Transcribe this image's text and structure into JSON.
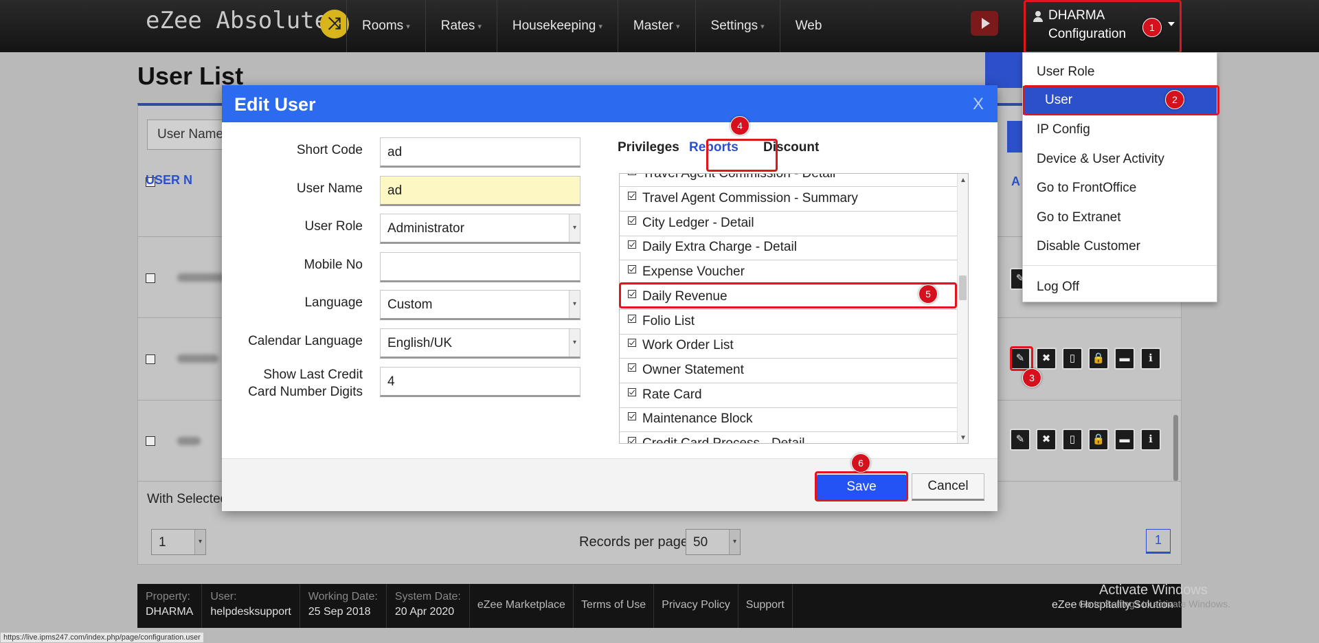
{
  "app": {
    "brand": "eZee Absolute",
    "nav": [
      "Rooms",
      "Rates",
      "Housekeeping",
      "Master",
      "Settings",
      "Web"
    ],
    "user_name": "DHARMA",
    "user_role": "Configuration"
  },
  "user_menu": {
    "items": [
      "User Role",
      "User",
      "IP Config",
      "Device & User Activity",
      "Go to FrontOffice",
      "Go to Extranet",
      "Disable Customer",
      "Log Off"
    ],
    "active": "User"
  },
  "page": {
    "title": "User List",
    "filter_label": "User Name",
    "col_user_name": "USER N",
    "col_actions": "A",
    "with_selected": "With Selected",
    "page_select": "1",
    "records_per_page_label": "Records per page",
    "records_per_page_value": "50",
    "current_page": "1"
  },
  "modal": {
    "title": "Edit User",
    "close": "X",
    "fields": {
      "short_code_label": "Short Code",
      "short_code_value": "ad",
      "user_name_label": "User Name",
      "user_name_value": "ad",
      "user_role_label": "User Role",
      "user_role_value": "Administrator",
      "mobile_label": "Mobile No",
      "mobile_value": "",
      "language_label": "Language",
      "language_value": "Custom",
      "cal_lang_label": "Calendar Language",
      "cal_lang_value": "English/UK",
      "card_digits_label_1": "Show Last Credit",
      "card_digits_label_2": "Card Number Digits",
      "card_digits_value": "4"
    },
    "tabs": [
      "Privileges",
      "Reports",
      "Discount"
    ],
    "active_tab": "Reports",
    "reports": [
      "Travel Agent Commission - Detail",
      "Travel Agent Commission - Summary",
      "City Ledger - Detail",
      "Daily Extra Charge - Detail",
      "Expense Voucher",
      "Daily Revenue",
      "Folio List",
      "Work Order List",
      "Owner Statement",
      "Rate Card",
      "Maintenance Block",
      "Credit Card Process - Detail"
    ],
    "save_label": "Save",
    "cancel_label": "Cancel"
  },
  "markers": [
    "1",
    "2",
    "3",
    "4",
    "5",
    "6"
  ],
  "footer": {
    "property_label": "Property:",
    "property_value": "DHARMA",
    "user_label": "User:",
    "user_value": "helpdesksupport",
    "working_date_label": "Working Date:",
    "working_date_value": "25 Sep 2018",
    "system_date_label": "System Date:",
    "system_date_value": "20 Apr 2020",
    "links": [
      "eZee Marketplace",
      "Terms of Use",
      "Privacy Policy",
      "Support"
    ],
    "right_text": "eZee Hospitality Solution"
  },
  "watermark": {
    "line1": "Activate Windows",
    "line2": "Go to Settings to activate Windows."
  },
  "status_url": "https://live.ipms247.com/index.php/page/configuration.user",
  "colors": {
    "accent_blue": "#2c50c9",
    "modal_header": "#2c6bf0",
    "highlight_red": "#e2141c"
  }
}
